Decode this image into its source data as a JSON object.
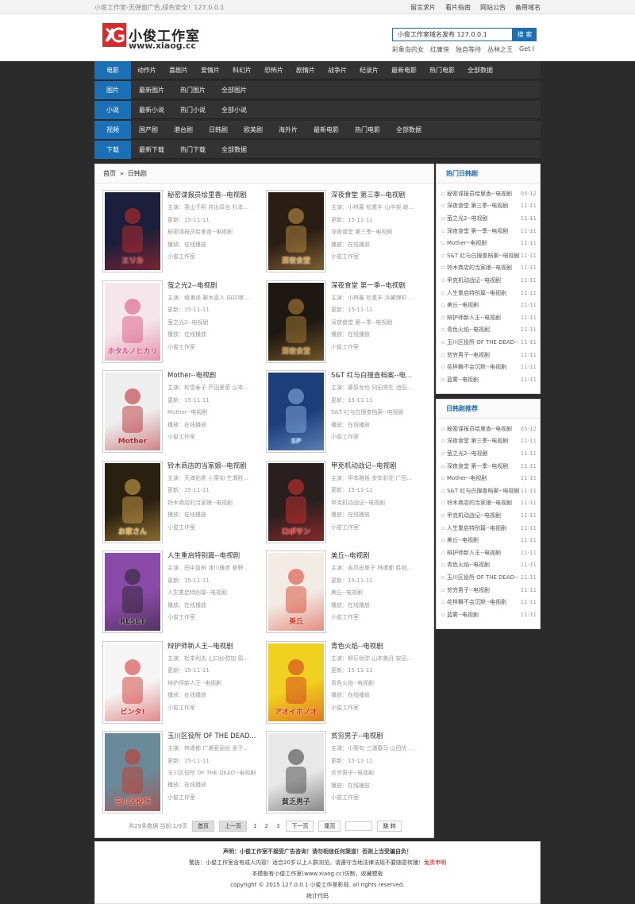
{
  "topbar": {
    "tip": "小俊工作室-无弹窗广告,绿色安全！127.0.0.1",
    "links": [
      "留言求片",
      "看片指南",
      "网站公告",
      "备用域名"
    ]
  },
  "header": {
    "logo_cn": "小俊工作室",
    "logo_en": "www.xiaog.cc",
    "search_value": "小俊工作室域名发布 127.0.0.1",
    "search_button": "搜 索",
    "hotwords": [
      "彩象岛的女",
      "红庸侠",
      "独自等待",
      "丛林之王",
      "Get I"
    ]
  },
  "nav": [
    {
      "cat": "电影",
      "items": [
        "动作片",
        "喜剧片",
        "爱情片",
        "科幻片",
        "恐怖片",
        "剧情片",
        "战争片",
        "纪录片",
        "最新电影",
        "热门电影",
        "全部数据"
      ]
    },
    {
      "cat": "图片",
      "items": [
        "最新图片",
        "热门图片",
        "全部图片"
      ]
    },
    {
      "cat": "小说",
      "items": [
        "最新小说",
        "热门小说",
        "全部小说"
      ]
    },
    {
      "cat": "视频",
      "items": [
        "国产剧",
        "港台剧",
        "日韩剧",
        "欧美剧",
        "海外片",
        "最新电影",
        "热门电影",
        "全部数据"
      ]
    },
    {
      "cat": "下载",
      "items": [
        "最新下载",
        "热门下载",
        "全部数据"
      ]
    }
  ],
  "breadcrumb": {
    "home": "首页",
    "sep": "»",
    "current": "日韩剧"
  },
  "items": [
    {
      "title": "秘密谍报员绘里香--电视剧",
      "actors": "主演：栗山千明 井出卓也 杉本...",
      "update": "更新：15-11-11",
      "name": "秘密谍报员绘里香--电视剧",
      "play": "播放：在线播放",
      "site": "小俊工作室",
      "poster_text": "エリカ",
      "colors": [
        "#1b1f3b",
        "#d22a2a"
      ]
    },
    {
      "title": "深夜食堂 第三季--电视剧",
      "actors": "主演：小林薰 松重丰 山中崇 綾...",
      "update": "更新：15-11-11",
      "name": "深夜食堂 第三季--电视剧",
      "play": "播放：在线播放",
      "site": "小俊工作室",
      "poster_text": "深夜食堂",
      "colors": [
        "#2a1d14",
        "#c89a4a"
      ]
    },
    {
      "title": "萤之光2--电视剧",
      "actors": "主演：绫濑遥 藤木直人 向井理 ...",
      "update": "更新：15-11-11",
      "name": "萤之光2--电视剧",
      "play": "播放：在线播放",
      "site": "小俊工作室",
      "poster_text": "ホタルノヒカリ",
      "colors": [
        "#f4e6ea",
        "#d94a7a"
      ]
    },
    {
      "title": "深夜食堂 第一季--电视剧",
      "actors": "主演：小林薰 松重丰 浜藏理彩 ...",
      "update": "更新：15-11-11",
      "name": "深夜食堂 第一季--电视剧",
      "play": "播放：在线播放",
      "site": "小俊工作室",
      "poster_text": "深夜食堂",
      "colors": [
        "#1e1812",
        "#b88a3a"
      ]
    },
    {
      "title": "Mother--电视剧",
      "actors": "主演：松雪泰子 芦田爱菜 山本...",
      "update": "更新：15-11-11",
      "name": "Mother--电视剧",
      "play": "播放：在线播放",
      "site": "小俊工作室",
      "poster_text": "Mother",
      "colors": [
        "#eeeeee",
        "#b5232a"
      ]
    },
    {
      "title": "S&T 红与白搜查档案--电...",
      "actors": "主演：藤原龙也 冈田将生 池田...",
      "update": "更新：15-11-11",
      "name": "S&T 红与白搜查档案--电视剧",
      "play": "播放：在线播放",
      "site": "小俊工作室",
      "poster_text": "SP",
      "colors": [
        "#1c3f7a",
        "#8fb8e8"
      ]
    },
    {
      "title": "铃木商店的当家娘--电视剧",
      "actors": "主演：天海佑希 小栗旬 生瀬胜...",
      "update": "更新：15-11-11",
      "name": "铃木商店的当家娘--电视剧",
      "play": "播放：在线播放",
      "site": "小俊工作室",
      "poster_text": "お家さん",
      "colors": [
        "#2a2010",
        "#e0b050"
      ]
    },
    {
      "title": "甲克机动战记--电视剧",
      "actors": "主演：甲本雅裕 安本彩花 广田...",
      "update": "更新：15-11-11",
      "name": "甲克机动战记--电视剧",
      "play": "播放：在线播放",
      "site": "小俊工作室",
      "poster_text": "ロボサン",
      "colors": [
        "#2a1f1f",
        "#e03030"
      ]
    },
    {
      "title": "人生重启特别篇--电视剧",
      "actors": "主演：田中直树 津川雅彦 寮野...",
      "update": "更新：15-11-11",
      "name": "人生重启特别篇--电视剧",
      "play": "播放：在线播放",
      "site": "小俊工作室",
      "poster_text": "RESET",
      "colors": [
        "#8a4aa8",
        "#222222"
      ]
    },
    {
      "title": "美丘--电视剧",
      "actors": "主演：吉高由里子 林遣都 胜地...",
      "update": "更新：15-11-11",
      "name": "美丘--电视剧",
      "play": "播放：在线播放",
      "site": "小俊工作室",
      "poster_text": "美丘",
      "colors": [
        "#f2ece4",
        "#d93a2a"
      ]
    },
    {
      "title": "辩护师新人王--电视剧",
      "actors": "主演：松本利夫 山口纱弥加 原...",
      "update": "更新：15-11-11",
      "name": "辩护师新人王--电视剧",
      "play": "播放：在线播放",
      "site": "小俊工作室",
      "poster_text": "ビンタ!",
      "colors": [
        "#f5f5f5",
        "#d02a2a"
      ]
    },
    {
      "title": "青色火焰--电视剧",
      "actors": "主演：柳乐优弥 山本美月 安田...",
      "update": "更新：15-11-11",
      "name": "青色火焰--电视剧",
      "play": "播放：在线播放",
      "site": "小俊工作室",
      "poster_text": "アオイホノオ",
      "colors": [
        "#f0d020",
        "#d03020"
      ]
    },
    {
      "title": "玉川区役所 OF THE DEAD...",
      "actors": "主演：林遣都 广濑爱丽丝 金子...",
      "update": "更新：15-11-11",
      "name": "玉川区役所 OF THE DEAD--电视剧",
      "play": "播放：在线播放",
      "site": "小俊工作室",
      "poster_text": "玉川区役所",
      "colors": [
        "#6a8a9a",
        "#d03020"
      ]
    },
    {
      "title": "贫穷男子--电视剧",
      "actors": "主演：小栗旬 三浦春马 山田优 ...",
      "update": "更新：15-11-11",
      "name": "贫穷男子--电视剧",
      "play": "播放：在线播放",
      "site": "小俊工作室",
      "poster_text": "貧乏男子",
      "colors": [
        "#e8e8e8",
        "#333333"
      ]
    }
  ],
  "pager": {
    "summary": "共29条数据 当前:1/3页",
    "first": "首页",
    "prev": "上一页",
    "pages": [
      "1",
      "2",
      "3"
    ],
    "next": "下一页",
    "last": "尾页",
    "jump": "跳 转"
  },
  "side1": {
    "title": "热门日韩剧",
    "list": [
      {
        "n": "秘密谍报员绘里香--电视剧",
        "d": "05-12"
      },
      {
        "n": "深夜食堂 第三季--电视剧",
        "d": "11-11"
      },
      {
        "n": "萤之光2--电视剧",
        "d": "11-11"
      },
      {
        "n": "深夜食堂 第一季--电视剧",
        "d": "11-11"
      },
      {
        "n": "Mother--电视剧",
        "d": "11-11"
      },
      {
        "n": "S&T 红与白搜查档案--电视剧",
        "d": "11-11"
      },
      {
        "n": "铃木商店的当家娘--电视剧",
        "d": "11-11"
      },
      {
        "n": "甲克机动战记--电视剧",
        "d": "11-11"
      },
      {
        "n": "人生重启特别篇--电视剧",
        "d": "11-11"
      },
      {
        "n": "美丘--电视剧",
        "d": "11-11"
      },
      {
        "n": "辩护师新人王--电视剧",
        "d": "11-11"
      },
      {
        "n": "青色火焰--电视剧",
        "d": "11-11"
      },
      {
        "n": "玉川区役所 OF THE DEAD--电视剧",
        "d": "11-11"
      },
      {
        "n": "贫穷男子--电视剧",
        "d": "11-11"
      },
      {
        "n": "花样舞不会沉默--电视剧",
        "d": "11-11"
      },
      {
        "n": "蓝雾--电视剧",
        "d": "11-11"
      }
    ]
  },
  "side2": {
    "title": "日韩剧推荐",
    "list": [
      {
        "n": "秘密谍报员绘里香--电视剧",
        "d": "05-12"
      },
      {
        "n": "深夜食堂 第三季--电视剧",
        "d": "11-11"
      },
      {
        "n": "萤之光2--电视剧",
        "d": "11-11"
      },
      {
        "n": "深夜食堂 第一季--电视剧",
        "d": "11-11"
      },
      {
        "n": "Mother--电视剧",
        "d": "11-11"
      },
      {
        "n": "S&T 红与白搜查档案--电视剧",
        "d": "11-11"
      },
      {
        "n": "铃木商店的当家娘--电视剧",
        "d": "11-11"
      },
      {
        "n": "甲克机动战记--电视剧",
        "d": "11-11"
      },
      {
        "n": "人生重启特别篇--电视剧",
        "d": "11-11"
      },
      {
        "n": "美丘--电视剧",
        "d": "11-11"
      },
      {
        "n": "辩护师新人王--电视剧",
        "d": "11-11"
      },
      {
        "n": "青色火焰--电视剧",
        "d": "11-11"
      },
      {
        "n": "玉川区役所 OF THE DEAD--电视剧",
        "d": "11-11"
      },
      {
        "n": "贫穷男子--电视剧",
        "d": "11-11"
      },
      {
        "n": "花样舞不会沉默--电视剧",
        "d": "11-11"
      },
      {
        "n": "蓝雾--电视剧",
        "d": "11-11"
      }
    ]
  },
  "footer": {
    "line1": "声明：小俊工作室不接受广告咨询！请勿相信任何渠道！否则上当受骗自负！",
    "line2_pre": "警告：小俊工作室含有成人内容！适合20岁以上人群浏览。请遵守当地法律法规不要随意转播！",
    "line2_red": "免责申明",
    "line3": "本模板有小俊工作室(www.xiaog.cc)仿制，收藏模板",
    "line4": "copyright © 2015 127.0.0.1 小俊工作室影视. all rights reserved.",
    "line5": "统计代码"
  },
  "colors": {
    "accent": "#1a6fb5",
    "nav_bg": "#333333",
    "page_bg": "#2b2b2b",
    "warn": "#dd0000"
  }
}
